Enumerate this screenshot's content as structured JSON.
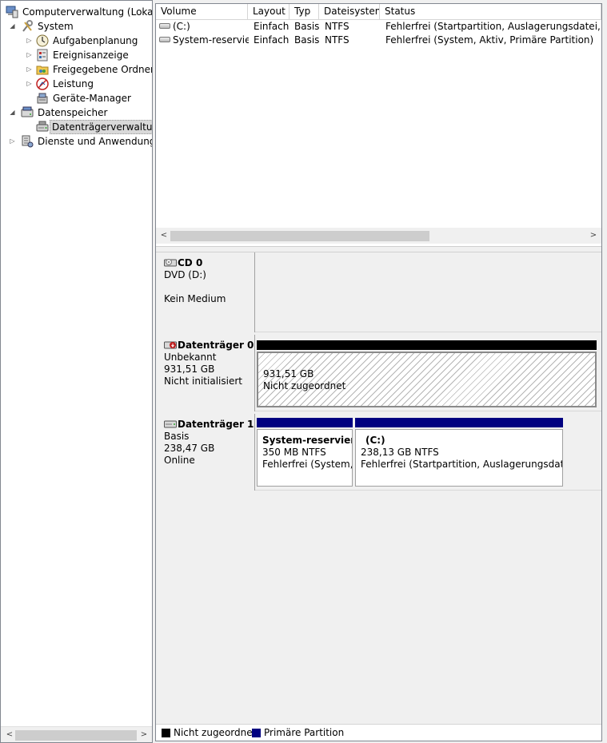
{
  "tree": {
    "root": "Computerverwaltung (Lokal)",
    "system": "System",
    "aufgabenplanung": "Aufgabenplanung",
    "ereignisanzeige": "Ereignisanzeige",
    "freigegebene_ordner": "Freigegebene Ordner",
    "leistung": "Leistung",
    "geraete_manager": "Geräte-Manager",
    "datenspeicher": "Datenspeicher",
    "datentraegerverwaltung": "Datenträgerverwaltung",
    "dienste": "Dienste und Anwendungen"
  },
  "volume_list": {
    "columns": [
      "Volume",
      "Layout",
      "Typ",
      "Dateisystem",
      "Status"
    ],
    "rows": [
      {
        "volume": "(C:)",
        "layout": "Einfach",
        "typ": "Basis",
        "dateisystem": "NTFS",
        "status": "Fehlerfrei (Startpartition, Auslagerungsdatei, Absturz"
      },
      {
        "volume": "System-reserviert",
        "layout": "Einfach",
        "typ": "Basis",
        "dateisystem": "NTFS",
        "status": "Fehlerfrei (System, Aktiv, Primäre Partition)"
      }
    ]
  },
  "disks": {
    "cd0": {
      "name": "CD 0",
      "type": "DVD (D:)",
      "status": "Kein Medium"
    },
    "disk0": {
      "name": "Datenträger 0",
      "type": "Unbekannt",
      "size": "931,51 GB",
      "status": "Nicht initialisiert",
      "partition": {
        "size": "931,51 GB",
        "state": "Nicht zugeordnet"
      }
    },
    "disk1": {
      "name": "Datenträger 1",
      "type": "Basis",
      "size": "238,47 GB",
      "status": "Online",
      "partitions": [
        {
          "name": "System-reserviert",
          "size": "350 MB NTFS",
          "status": "Fehlerfrei (System, A"
        },
        {
          "name": "(C:)",
          "size": "238,13 GB NTFS",
          "status": "Fehlerfrei (Startpartition, Auslagerungsdatei, Ab"
        }
      ]
    }
  },
  "legend": {
    "unallocated": "Nicht zugeordnet",
    "primary": "Primäre Partition"
  },
  "colors": {
    "unallocated": "#000000",
    "primary": "#000080",
    "selection": "#d9d9d9"
  },
  "scroll_arrows": {
    "left": "<",
    "right": ">"
  },
  "tree_arrows": {
    "expanded": "◢",
    "collapsed": "▷"
  }
}
